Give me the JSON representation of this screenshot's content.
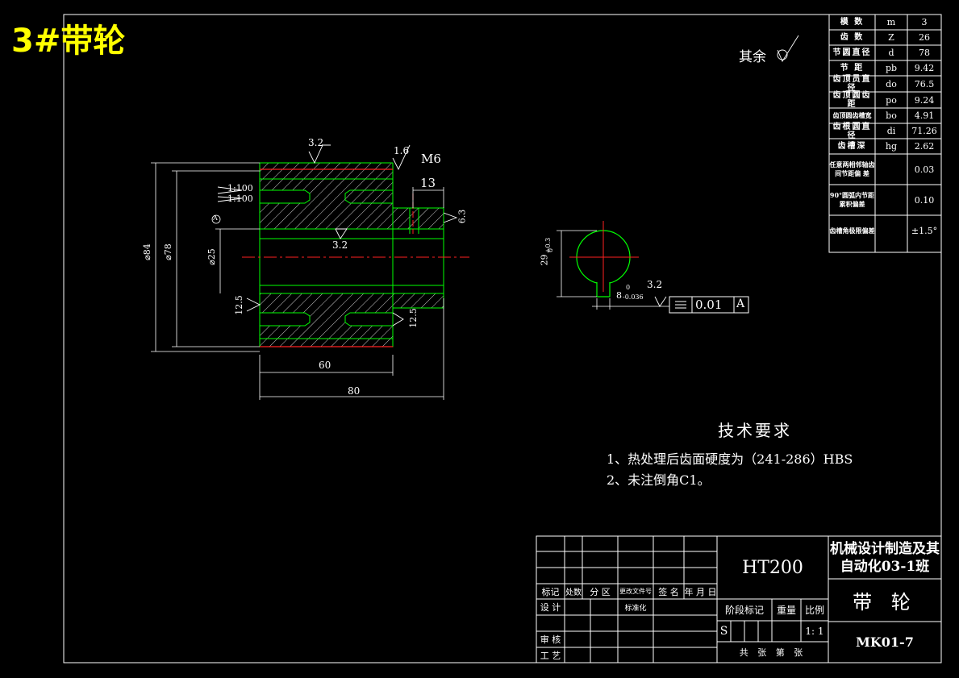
{
  "sheet_title": "3#带轮",
  "roughness_other": "其余",
  "dimensions": {
    "d84": "⌀84",
    "d78": "⌀78",
    "d25": "⌀25",
    "l60": "60",
    "l80": "80",
    "l13": "13",
    "r32_top": "3.2",
    "r32_mid": "3.2",
    "r16": "1.6",
    "m6": "M6",
    "taper1": "1:100",
    "taper2": "1:100",
    "r63": "6.3",
    "r125_left": "12.5",
    "r125_right": "12.5",
    "datum_a": "A",
    "key_29": "29",
    "key_29_tol_up": "+0.3",
    "key_29_tol_low": "0",
    "key_8": "8",
    "key_8_tol_up": "0",
    "key_8_tol_low": "-0.036",
    "key_r32": "3.2",
    "tol_value": "0.01",
    "tol_datum": "A"
  },
  "gear_table": [
    {
      "name": "模 数",
      "symbol": "m",
      "value": "3"
    },
    {
      "name": "齿 数",
      "symbol": "Z",
      "value": "26"
    },
    {
      "name": "节圆直径",
      "symbol": "d",
      "value": "78"
    },
    {
      "name": "节 距",
      "symbol": "pb",
      "value": "9.42"
    },
    {
      "name": "齿顶员直径",
      "symbol": "do",
      "value": "76.5"
    },
    {
      "name": "齿顶圆齿距",
      "symbol": "po",
      "value": "9.24"
    },
    {
      "name": "齿顶圆齿槽宽",
      "symbol": "bo",
      "value": "4.91"
    },
    {
      "name": "齿根圆直径",
      "symbol": "di",
      "value": "71.26"
    },
    {
      "name": "齿槽深",
      "symbol": "hg",
      "value": "2.62"
    },
    {
      "name": "任意两相邻轴齿间节距偏 差",
      "symbol": "",
      "value": "0.03"
    },
    {
      "name": "90°圆弧内节距累积偏差",
      "symbol": "",
      "value": "0.10"
    },
    {
      "name": "齿槽角极限偏差",
      "symbol": "",
      "value": "±1.5°"
    }
  ],
  "tech_req": {
    "title": "技术要求",
    "items": [
      "1、热处理后齿面硬度为（241-286）HBS",
      "2、未注倒角C1。"
    ]
  },
  "title_block": {
    "material": "HT200",
    "school": "机械设计制造及其自动化03-1班",
    "part_name": "带 轮",
    "drawing_no": "MK01-7",
    "labels": {
      "biaoji": "标记",
      "chushu": "处数",
      "fenqu": "分 区",
      "gengai": "更改文件号",
      "qianming": "签 名",
      "nianyueri": "年 月 日",
      "sheji": "设 计",
      "biaozhunhua": "标准化",
      "shenhe": "审 核",
      "gongyi": "工 艺",
      "jieduan": "阶段标记",
      "zhongliang": "重量",
      "bili": "比例",
      "s": "S",
      "scale": "1: 1",
      "gong_zhang": "共 张 第 张"
    }
  }
}
